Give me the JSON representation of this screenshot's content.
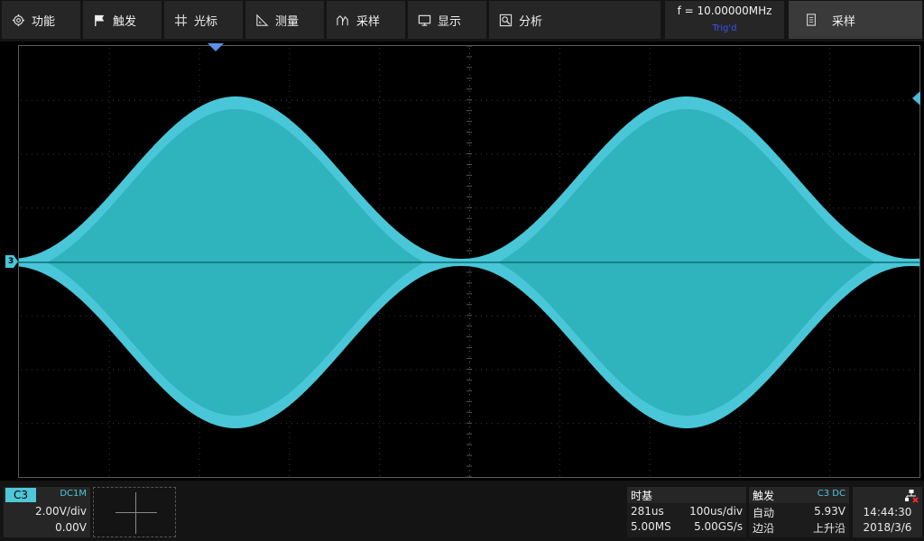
{
  "menu": {
    "items": [
      {
        "label": "功能",
        "icon": "gear-icon"
      },
      {
        "label": "触发",
        "icon": "flag-icon"
      },
      {
        "label": "光标",
        "icon": "cursor-grid-icon"
      },
      {
        "label": "测量",
        "icon": "ruler-icon"
      },
      {
        "label": "采样",
        "icon": "sampling-icon"
      },
      {
        "label": "显示",
        "icon": "monitor-icon"
      },
      {
        "label": "分析",
        "icon": "analysis-icon"
      }
    ],
    "frequency": "f = 10.00000MHz",
    "trig_status": "Trig'd",
    "acquire_button": "采样"
  },
  "channel": {
    "name": "C3",
    "coupling": "DC1M",
    "scale": "2.00V/div",
    "offset": "0.00V",
    "marker": "3",
    "color": "#49c7d8"
  },
  "timebase": {
    "title": "时基",
    "delay": "281us",
    "scale": "100us/div",
    "memory": "5.00MS",
    "sample_rate": "5.00GS/s"
  },
  "trigger": {
    "title": "触发",
    "source": "C3 DC",
    "mode": "自动",
    "level": "5.93V",
    "type": "边沿",
    "slope": "上升沿"
  },
  "clock": {
    "time": "14:44:30",
    "date": "2018/3/6"
  }
}
